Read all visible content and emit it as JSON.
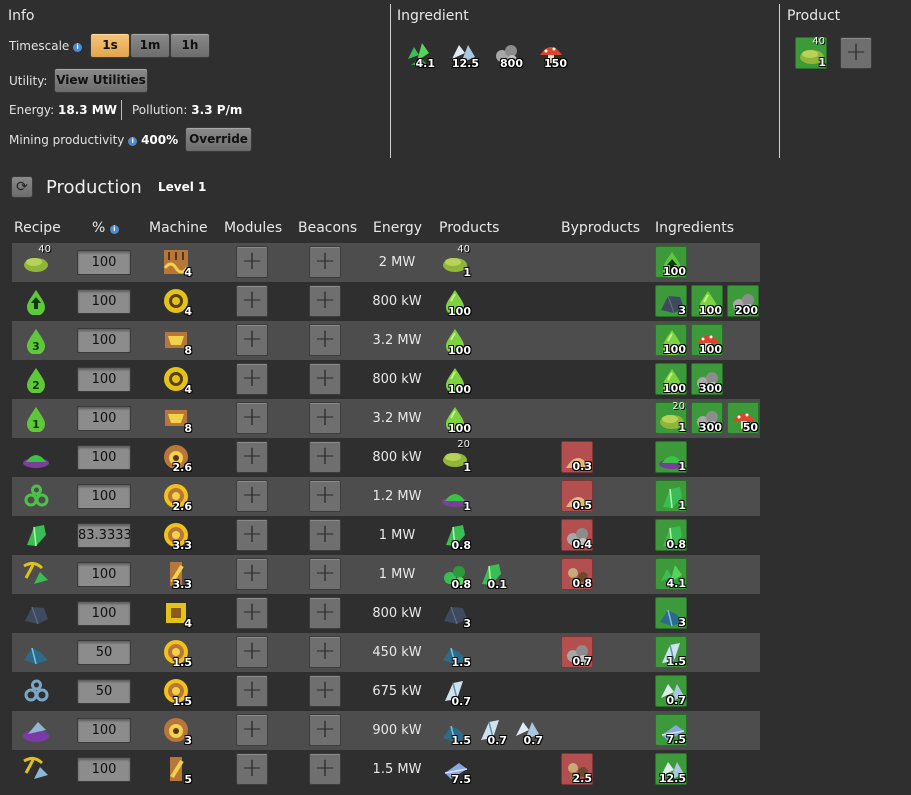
{
  "info": {
    "title": "Info",
    "timescale_label": "Timescale",
    "timescale_options": [
      "1s",
      "1m",
      "1h"
    ],
    "timescale_selected": "1s",
    "utility_label": "Utility:",
    "view_utilities_button": "View Utilities",
    "energy_label": "Energy:",
    "energy_value": "18.3 MW",
    "pollution_label": "Pollution:",
    "pollution_value": "3.3 P/m",
    "mining_label": "Mining productivity",
    "mining_value": "400%",
    "override_button": "Override"
  },
  "ingredient_panel": {
    "title": "Ingredient",
    "items": [
      {
        "icon": "green-crystal-cluster-icon",
        "amount": "4.1"
      },
      {
        "icon": "white-crystal-icon",
        "amount": "12.5"
      },
      {
        "icon": "stone-ore-icon",
        "amount": "800"
      },
      {
        "icon": "red-mushroom-icon",
        "amount": "150"
      }
    ]
  },
  "product_panel": {
    "title": "Product",
    "item": {
      "icon": "green-paste-icon",
      "top": "40",
      "amount": "1"
    }
  },
  "production": {
    "title": "Production",
    "level": "Level 1",
    "headers": {
      "recipe": "Recipe",
      "pct": "%",
      "machine": "Machine",
      "modules": "Modules",
      "beacons": "Beacons",
      "energy": "Energy",
      "products": "Products",
      "byproducts": "Byproducts",
      "ingredients": "Ingredients"
    },
    "rows": [
      {
        "recipe": {
          "icon": "green-paste-icon",
          "top": "40"
        },
        "pct": "100",
        "machine": {
          "icon": "drill-machine-icon",
          "amount": "4"
        },
        "energy": "2 MW",
        "products": [
          {
            "icon": "green-paste-icon",
            "top": "40",
            "amount": "1"
          }
        ],
        "byproducts": [],
        "ingredients": [
          {
            "icon": "green-arrow-drop-icon",
            "amount": "100"
          }
        ]
      },
      {
        "recipe": {
          "icon": "green-arrow-drop-icon"
        },
        "pct": "100",
        "machine": {
          "icon": "centrifuge-icon",
          "amount": "4"
        },
        "energy": "800 kW",
        "products": [
          {
            "icon": "green-drop-icon",
            "amount": "100"
          }
        ],
        "byproducts": [],
        "ingredients": [
          {
            "icon": "coal-icon",
            "amount": "3"
          },
          {
            "icon": "green-drop-icon",
            "amount": "100"
          },
          {
            "icon": "stone-ore-icon",
            "amount": "200"
          }
        ]
      },
      {
        "recipe": {
          "icon": "green-drop-3-icon"
        },
        "pct": "100",
        "machine": {
          "icon": "vat-icon",
          "amount": "8"
        },
        "energy": "3.2 MW",
        "products": [
          {
            "icon": "green-drop-icon",
            "amount": "100"
          }
        ],
        "byproducts": [],
        "ingredients": [
          {
            "icon": "green-drop-icon",
            "amount": "100"
          },
          {
            "icon": "red-mushroom-icon",
            "amount": "100"
          }
        ]
      },
      {
        "recipe": {
          "icon": "green-drop-2-icon"
        },
        "pct": "100",
        "machine": {
          "icon": "centrifuge-icon",
          "amount": "4"
        },
        "energy": "800 kW",
        "products": [
          {
            "icon": "green-drop-icon",
            "amount": "100"
          }
        ],
        "byproducts": [],
        "ingredients": [
          {
            "icon": "green-drop-icon",
            "amount": "100"
          },
          {
            "icon": "stone-ore-icon",
            "amount": "300"
          }
        ]
      },
      {
        "recipe": {
          "icon": "green-drop-1-icon"
        },
        "pct": "100",
        "machine": {
          "icon": "vat-icon",
          "amount": "8"
        },
        "energy": "3.2 MW",
        "products": [
          {
            "icon": "green-drop-icon",
            "amount": "100"
          }
        ],
        "byproducts": [],
        "ingredients": [
          {
            "icon": "green-paste-icon",
            "top": "20",
            "amount": "1"
          },
          {
            "icon": "stone-ore-icon",
            "amount": "300"
          },
          {
            "icon": "red-mushroom-icon",
            "amount": "50"
          }
        ]
      },
      {
        "recipe": {
          "icon": "green-mound-icon"
        },
        "pct": "100",
        "machine": {
          "icon": "furnace-icon",
          "amount": "2.6"
        },
        "energy": "800 kW",
        "products": [
          {
            "icon": "green-paste-icon",
            "top": "20",
            "amount": "1"
          }
        ],
        "byproducts": [
          {
            "icon": "sand-pile-icon",
            "amount": "0.3"
          }
        ],
        "ingredients": [
          {
            "icon": "green-mound-icon",
            "amount": "1"
          }
        ]
      },
      {
        "recipe": {
          "icon": "green-gears-icon"
        },
        "pct": "100",
        "machine": {
          "icon": "crusher-icon",
          "amount": "2.6"
        },
        "energy": "1.2 MW",
        "products": [
          {
            "icon": "green-mound-icon",
            "amount": "1"
          }
        ],
        "byproducts": [
          {
            "icon": "sand-pile-icon",
            "amount": "0.5"
          }
        ],
        "ingredients": [
          {
            "icon": "green-crystal-icon",
            "amount": "1"
          }
        ]
      },
      {
        "recipe": {
          "icon": "green-crystal-icon"
        },
        "pct": "83.3333",
        "machine": {
          "icon": "crusher-icon",
          "amount": "3.3"
        },
        "energy": "1 MW",
        "products": [
          {
            "icon": "green-crystal-icon",
            "amount": "0.8"
          }
        ],
        "byproducts": [
          {
            "icon": "stone-ore-icon",
            "amount": "0.4"
          }
        ],
        "ingredients": [
          {
            "icon": "green-crystal-icon",
            "amount": "0.8"
          }
        ]
      },
      {
        "recipe": {
          "icon": "pickaxe-green-icon"
        },
        "pct": "100",
        "machine": {
          "icon": "sorter-icon",
          "amount": "3.3"
        },
        "energy": "1 MW",
        "products": [
          {
            "icon": "green-ore-icon",
            "amount": "0.8"
          },
          {
            "icon": "green-crystal-icon",
            "amount": "0.1"
          }
        ],
        "byproducts": [
          {
            "icon": "mixed-ore-icon",
            "amount": "0.8"
          }
        ],
        "ingredients": [
          {
            "icon": "green-crystal-cluster-icon",
            "amount": "4.1"
          }
        ]
      },
      {
        "recipe": {
          "icon": "coal-icon"
        },
        "pct": "100",
        "machine": {
          "icon": "press-icon",
          "amount": "4"
        },
        "energy": "800 kW",
        "products": [
          {
            "icon": "coal-icon",
            "amount": "3"
          }
        ],
        "byproducts": [],
        "ingredients": [
          {
            "icon": "blue-ore-icon",
            "amount": "3"
          }
        ]
      },
      {
        "recipe": {
          "icon": "blue-ore-icon"
        },
        "pct": "50",
        "machine": {
          "icon": "crusher-icon",
          "amount": "1.5"
        },
        "energy": "450 kW",
        "products": [
          {
            "icon": "blue-ore-icon",
            "amount": "1.5"
          }
        ],
        "byproducts": [
          {
            "icon": "stone-ore-icon",
            "amount": "0.7"
          }
        ],
        "ingredients": [
          {
            "icon": "white-shard-icon",
            "amount": "1.5"
          }
        ]
      },
      {
        "recipe": {
          "icon": "blue-gears-icon"
        },
        "pct": "50",
        "machine": {
          "icon": "crusher-icon",
          "amount": "1.5"
        },
        "energy": "675 kW",
        "products": [
          {
            "icon": "white-shard-icon",
            "amount": "0.7"
          }
        ],
        "byproducts": [],
        "ingredients": [
          {
            "icon": "white-crystal-icon",
            "amount": "0.7"
          }
        ]
      },
      {
        "recipe": {
          "icon": "purple-bowl-icon"
        },
        "pct": "100",
        "machine": {
          "icon": "furnace-icon",
          "amount": "3"
        },
        "energy": "900 kW",
        "products": [
          {
            "icon": "blue-ore-icon",
            "amount": "1.5"
          },
          {
            "icon": "white-shard-icon",
            "amount": "0.7"
          },
          {
            "icon": "white-crystal-icon",
            "amount": "0.7"
          }
        ],
        "byproducts": [],
        "ingredients": [
          {
            "icon": "blue-shard-icon",
            "amount": "7.5"
          }
        ]
      },
      {
        "recipe": {
          "icon": "pickaxe-blue-icon"
        },
        "pct": "100",
        "machine": {
          "icon": "sorter-icon",
          "amount": "5"
        },
        "energy": "1.5 MW",
        "products": [
          {
            "icon": "blue-shard-icon",
            "amount": "7.5"
          }
        ],
        "byproducts": [
          {
            "icon": "mixed-ore-icon",
            "amount": "2.5"
          }
        ],
        "ingredients": [
          {
            "icon": "white-crystal-icon",
            "amount": "12.5"
          }
        ]
      }
    ]
  }
}
